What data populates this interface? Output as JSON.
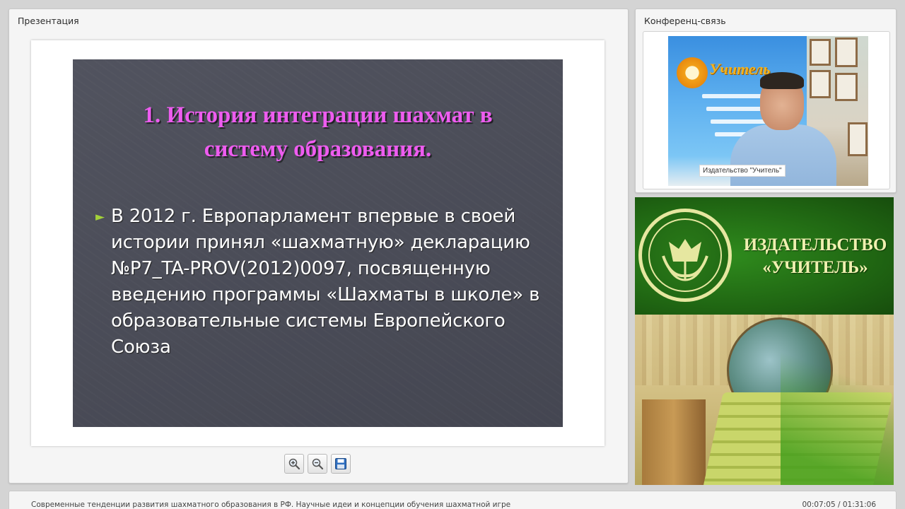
{
  "presentation": {
    "panel_title": "Презентация",
    "slide": {
      "title": "1. История интеграции шахмат в систему образования.",
      "bullet_marker": "►",
      "bullet_text": "В 2012 г. Европарламент впервые в своей истории принял «шахматную» декларацию №P7_TA-PROV(2012)0097, посвященную введению программы «Шахматы в школе» в образовательные системы Европейского Союза"
    },
    "toolbar": {
      "zoom_in_icon": "zoom-in-icon",
      "zoom_out_icon": "zoom-out-icon",
      "save_icon": "save-icon"
    }
  },
  "conference": {
    "panel_title": "Конференц-связь",
    "video_caption": "Издательство \"Учитель\"",
    "banner_word": "Учитель"
  },
  "publisher": {
    "name": "ИЗДАТЕЛЬСТВО «УЧИТЕЛЬ»"
  },
  "status": {
    "title": "Современные тенденции развития шахматного образования в РФ. Научные идеи и концепции обучения шахматной игре",
    "time": "00:07:05 / 01:31:06"
  },
  "colors": {
    "slide_bg": "#4a4c58",
    "slide_title": "#ee5cf0",
    "bullet_marker": "#a3d13a",
    "publisher_green": "#1f6412",
    "publisher_text": "#f0f0b0"
  }
}
